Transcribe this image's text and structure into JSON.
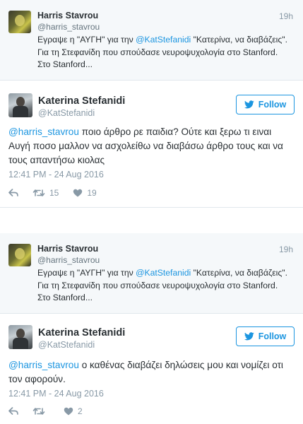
{
  "colors": {
    "accent": "#1b95e0",
    "muted": "#8899a6",
    "text": "#292f33",
    "quoted_bg": "#f5f8fa"
  },
  "threads": [
    {
      "quoted": {
        "name": "Harris Stavrou",
        "handle": "@harris_stavrou",
        "time": "19h",
        "text_pre": "Εγραψε η \"ΑΥΓΗ\" για την ",
        "mention": "@KatStefanidi",
        "text_line1_post": " \"Κατερίνα, να διαβάζεις\".",
        "text_line2": "Για τη Στεφανίδη που σπούδασε νευροψυχολογία στο Stanford.",
        "text_line3": "Στο Stanford..."
      },
      "reply": {
        "name": "Katerina Stefanidi",
        "handle": "@KatStefanidi",
        "follow_label": "Follow",
        "mention": "@harris_stavrou",
        "text_line1": " ποιο άρθρο ρε παιδια? Ούτε και ξερω τι ειναι",
        "text_line2": "Αυγή ποσο μαλλον να ασχολείθω να διαβάσω άρθρο τους και να",
        "text_line3": "τους απαντήσω κιολας",
        "timestamp": "12:41 PM - 24 Aug 2016",
        "retweets": "15",
        "likes": "19",
        "icons": [
          "reply-icon",
          "retweet-icon",
          "heart-icon"
        ]
      }
    },
    {
      "quoted": {
        "name": "Harris Stavrou",
        "handle": "@harris_stavrou",
        "time": "19h",
        "text_pre": "Εγραψε η \"ΑΥΓΗ\" για την ",
        "mention": "@KatStefanidi",
        "text_line1_post": " \"Κατερίνα, να διαβάζεις\".",
        "text_line2": "Για τη Στεφανίδη που σπούδασε νευροψυχολογία στο Stanford.",
        "text_line3": "Στο Stanford..."
      },
      "reply": {
        "name": "Katerina Stefanidi",
        "handle": "@KatStefanidi",
        "follow_label": "Follow",
        "mention": "@harris_stavrou",
        "text_line1": " ο καθένας διαβάζει δηλώσεις μου και νομίζει οτι",
        "text_line2": "τον αφορούν.",
        "timestamp": "12:41 PM - 24 Aug 2016",
        "retweets": "",
        "likes": "2",
        "icons": [
          "reply-icon",
          "retweet-icon",
          "heart-icon"
        ]
      }
    }
  ]
}
